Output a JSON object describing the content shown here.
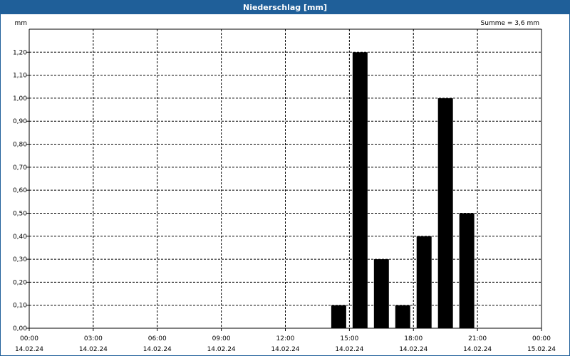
{
  "window": {
    "title": "Niederschlag [mm]"
  },
  "chart_data": {
    "type": "bar",
    "title": "Niederschlag [mm]",
    "ylabel": "mm",
    "summary": "Summe = 3,6 mm",
    "ylim": [
      0,
      1.3
    ],
    "y_ticks": [
      0.0,
      0.1,
      0.2,
      0.3,
      0.4,
      0.5,
      0.6,
      0.7,
      0.8,
      0.9,
      1.0,
      1.1,
      1.2
    ],
    "y_tick_labels": [
      "0,00",
      "0,10",
      "0,20",
      "0,30",
      "0,40",
      "0,50",
      "0,60",
      "0,70",
      "0,80",
      "0,90",
      "1,00",
      "1,10",
      "1,20"
    ],
    "x_range_hours": [
      0,
      24
    ],
    "x_ticks": [
      {
        "time": "00:00",
        "date": "14.02.24",
        "hour": 0
      },
      {
        "time": "03:00",
        "date": "14.02.24",
        "hour": 3
      },
      {
        "time": "06:00",
        "date": "14.02.24",
        "hour": 6
      },
      {
        "time": "09:00",
        "date": "14.02.24",
        "hour": 9
      },
      {
        "time": "12:00",
        "date": "14.02.24",
        "hour": 12
      },
      {
        "time": "15:00",
        "date": "14.02.24",
        "hour": 15
      },
      {
        "time": "18:00",
        "date": "14.02.24",
        "hour": 18
      },
      {
        "time": "21:00",
        "date": "14.02.24",
        "hour": 21
      },
      {
        "time": "00:00",
        "date": "15.02.24",
        "hour": 24
      }
    ],
    "bars": [
      {
        "hour": 14.5,
        "value": 0.1
      },
      {
        "hour": 15.5,
        "value": 1.2
      },
      {
        "hour": 16.5,
        "value": 0.3
      },
      {
        "hour": 17.5,
        "value": 0.1
      },
      {
        "hour": 18.5,
        "value": 0.4
      },
      {
        "hour": 19.5,
        "value": 1.0
      },
      {
        "hour": 20.5,
        "value": 0.5
      }
    ],
    "bar_color": "#000000",
    "grid": true,
    "grid_style": "dashed"
  }
}
